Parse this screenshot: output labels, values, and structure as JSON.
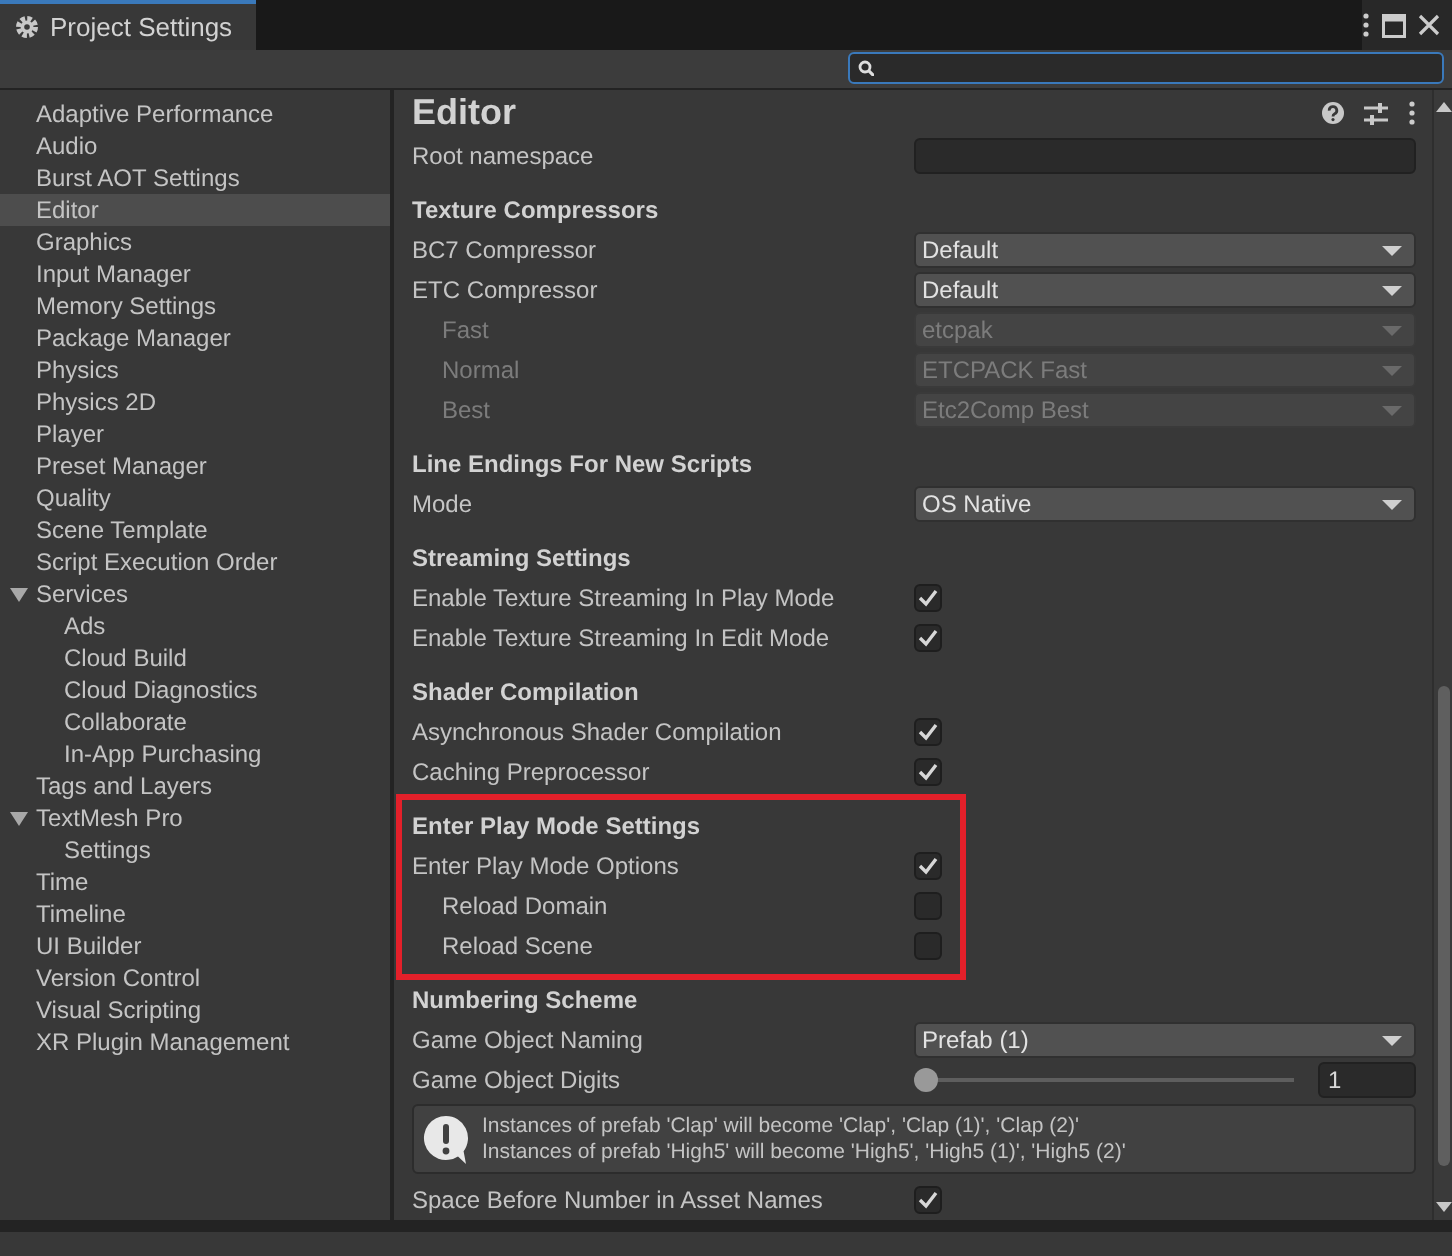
{
  "window": {
    "title": "Project Settings"
  },
  "sidebar": {
    "items": [
      {
        "label": "Adaptive Performance",
        "selected": false
      },
      {
        "label": "Audio",
        "selected": false
      },
      {
        "label": "Burst AOT Settings",
        "selected": false
      },
      {
        "label": "Editor",
        "selected": true
      },
      {
        "label": "Graphics",
        "selected": false
      },
      {
        "label": "Input Manager",
        "selected": false
      },
      {
        "label": "Memory Settings",
        "selected": false
      },
      {
        "label": "Package Manager",
        "selected": false
      },
      {
        "label": "Physics",
        "selected": false
      },
      {
        "label": "Physics 2D",
        "selected": false
      },
      {
        "label": "Player",
        "selected": false
      },
      {
        "label": "Preset Manager",
        "selected": false
      },
      {
        "label": "Quality",
        "selected": false
      },
      {
        "label": "Scene Template",
        "selected": false
      },
      {
        "label": "Script Execution Order",
        "selected": false
      },
      {
        "label": "Services",
        "selected": false,
        "expanded": true,
        "children": [
          {
            "label": "Ads",
            "selected": false
          },
          {
            "label": "Cloud Build",
            "selected": false
          },
          {
            "label": "Cloud Diagnostics",
            "selected": false
          },
          {
            "label": "Collaborate",
            "selected": false
          },
          {
            "label": "In-App Purchasing",
            "selected": false
          }
        ]
      },
      {
        "label": "Tags and Layers",
        "selected": false
      },
      {
        "label": "TextMesh Pro",
        "selected": false,
        "expanded": true,
        "children": [
          {
            "label": "Settings",
            "selected": false
          }
        ]
      },
      {
        "label": "Time",
        "selected": false
      },
      {
        "label": "Timeline",
        "selected": false
      },
      {
        "label": "UI Builder",
        "selected": false
      },
      {
        "label": "Version Control",
        "selected": false
      },
      {
        "label": "Visual Scripting",
        "selected": false
      },
      {
        "label": "XR Plugin Management",
        "selected": false
      }
    ]
  },
  "editor": {
    "title": "Editor",
    "sections": [
      {
        "rows": [
          {
            "kind": "text",
            "label": "Root namespace"
          }
        ]
      },
      {
        "title": "Texture Compressors",
        "rows": [
          {
            "kind": "dropdown",
            "label": "BC7 Compressor",
            "value": "Default",
            "disabled": false
          },
          {
            "kind": "dropdown",
            "label": "ETC Compressor",
            "value": "Default",
            "disabled": false,
            "children": [
              {
                "kind": "dropdown",
                "label": "Fast",
                "value": "etcpak",
                "disabled": true
              },
              {
                "kind": "dropdown",
                "label": "Normal",
                "value": "ETCPACK Fast",
                "disabled": true
              },
              {
                "kind": "dropdown",
                "label": "Best",
                "value": "Etc2Comp Best",
                "disabled": true
              }
            ]
          }
        ]
      },
      {
        "title": "Line Endings For New Scripts",
        "rows": [
          {
            "kind": "dropdown",
            "label": "Mode",
            "value": "OS Native",
            "disabled": false
          }
        ]
      },
      {
        "title": "Streaming Settings",
        "rows": [
          {
            "kind": "checkbox",
            "label": "Enable Texture Streaming In Play Mode",
            "checked": true
          },
          {
            "kind": "checkbox",
            "label": "Enable Texture Streaming In Edit Mode",
            "checked": true
          }
        ]
      },
      {
        "title": "Shader Compilation",
        "rows": [
          {
            "kind": "checkbox",
            "label": "Asynchronous Shader Compilation",
            "checked": true
          },
          {
            "kind": "checkbox",
            "label": "Caching Preprocessor",
            "checked": true
          }
        ]
      },
      {
        "title": "Enter Play Mode Settings",
        "highlighted": true,
        "rows": [
          {
            "kind": "checkbox",
            "label": "Enter Play Mode Options",
            "checked": true,
            "children": [
              {
                "kind": "checkbox",
                "label": "Reload Domain",
                "checked": false
              },
              {
                "kind": "checkbox",
                "label": "Reload Scene",
                "checked": false
              }
            ]
          }
        ]
      },
      {
        "title": "Numbering Scheme",
        "rows": [
          {
            "kind": "dropdown",
            "label": "Game Object Naming",
            "value": "Prefab (1)",
            "disabled": false
          },
          {
            "kind": "slider",
            "label": "Game Object Digits",
            "level": 0,
            "value": "1"
          },
          {
            "kind": "help",
            "lines": [
              "Instances of prefab 'Clap' will become 'Clap', 'Clap (1)', 'Clap (2)'",
              "Instances of prefab 'High5' will become 'High5', 'High5 (1)', 'High5 (2)'"
            ]
          },
          {
            "kind": "checkbox",
            "label": "Space Before Number in Asset Names",
            "checked": true
          }
        ]
      }
    ]
  }
}
